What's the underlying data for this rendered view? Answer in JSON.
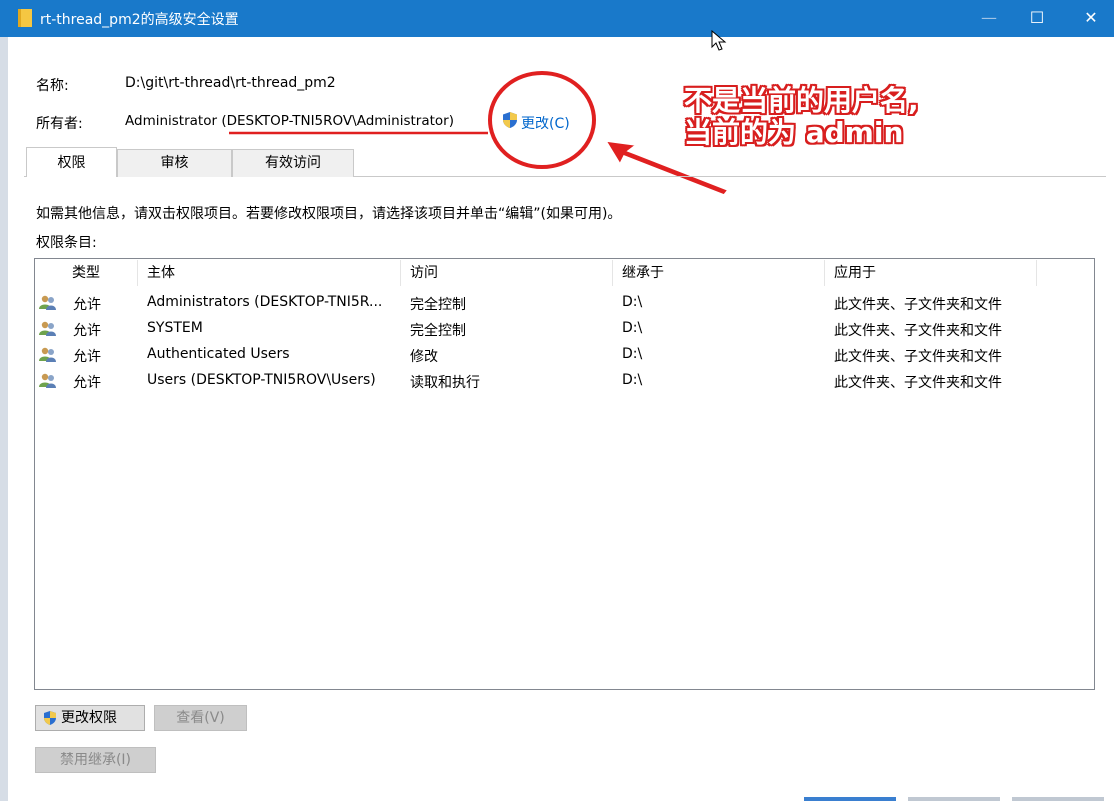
{
  "window": {
    "title": "rt-thread_pm2的高级安全设置",
    "minimize_glyph": "—",
    "maximize_glyph": "☐",
    "close_glyph": "✕"
  },
  "info": {
    "name_label": "名称:",
    "name_value": "D:\\git\\rt-thread\\rt-thread_pm2",
    "owner_label": "所有者:",
    "owner_value": "Administrator (DESKTOP-TNI5ROV\\Administrator)",
    "change_link": "更改(C)"
  },
  "tabs": [
    {
      "label": "权限"
    },
    {
      "label": "审核"
    },
    {
      "label": "有效访问"
    }
  ],
  "hint": "如需其他信息，请双击权限项目。若要修改权限项目，请选择该项目并单击“编辑”(如果可用)。",
  "entries_label": "权限条目:",
  "table": {
    "headers": [
      "类型",
      "主体",
      "访问",
      "继承于",
      "应用于"
    ],
    "rows": [
      {
        "type": "允许",
        "principal": "Administrators (DESKTOP-TNI5R...",
        "access": "完全控制",
        "inherited": "D:\\",
        "applies": "此文件夹、子文件夹和文件"
      },
      {
        "type": "允许",
        "principal": "SYSTEM",
        "access": "完全控制",
        "inherited": "D:\\",
        "applies": "此文件夹、子文件夹和文件"
      },
      {
        "type": "允许",
        "principal": "Authenticated Users",
        "access": "修改",
        "inherited": "D:\\",
        "applies": "此文件夹、子文件夹和文件"
      },
      {
        "type": "允许",
        "principal": "Users (DESKTOP-TNI5ROV\\Users)",
        "access": "读取和执行",
        "inherited": "D:\\",
        "applies": "此文件夹、子文件夹和文件"
      }
    ]
  },
  "buttons": {
    "change_permissions": "更改权限",
    "view": "查看(V)",
    "disable_inheritance": "禁用继承(I)"
  },
  "annotation": {
    "line1": "不是当前的用户名,",
    "line2": "当前的为 admin",
    "color": "#e02020"
  },
  "colors": {
    "titlebar": "#1979ca",
    "link": "#0066cc",
    "shield_blue": "#2a6fd0",
    "shield_yellow": "#f2c94c"
  }
}
